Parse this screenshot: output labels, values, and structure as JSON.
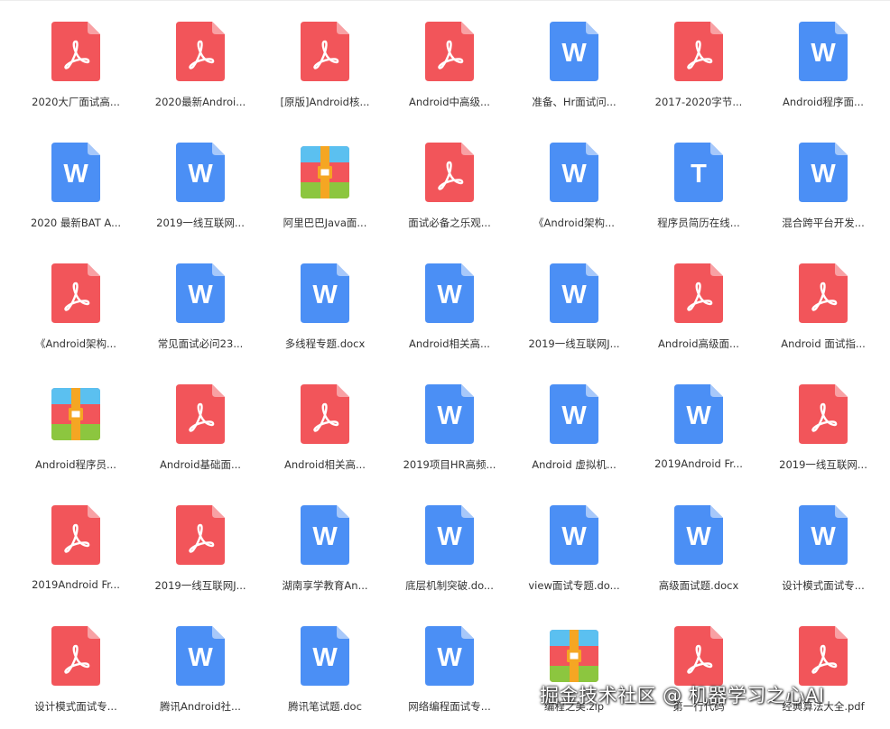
{
  "colors": {
    "pdf": "#f2555a",
    "pdf_fold": "#f8a1a4",
    "word": "#4b8ff5",
    "word_fold": "#a7c8fa",
    "text": "#4b8ff5",
    "zip_top": "#5bc0f0",
    "zip_mid": "#f2555a",
    "zip_bottom": "#8cc63f",
    "zip_strap": "#f5a623"
  },
  "icons": {
    "pdf": "pdf-file-icon",
    "word": "word-file-icon",
    "text": "text-file-icon",
    "zip": "zip-archive-icon",
    "word_letter": "W",
    "text_letter": "T"
  },
  "files": [
    [
      {
        "type": "pdf",
        "name": "2020大厂面试高..."
      },
      {
        "type": "pdf",
        "name": "2020最新Androi..."
      },
      {
        "type": "pdf",
        "name": "[原版]Android核..."
      },
      {
        "type": "pdf",
        "name": "Android中高级..."
      },
      {
        "type": "word",
        "name": "准备、Hr面试问..."
      },
      {
        "type": "pdf",
        "name": "2017-2020字节..."
      },
      {
        "type": "word",
        "name": "Android程序面..."
      }
    ],
    [
      {
        "type": "word",
        "name": "2020 最新BAT A..."
      },
      {
        "type": "word",
        "name": "2019一线互联网..."
      },
      {
        "type": "zip",
        "name": "阿里巴巴Java面..."
      },
      {
        "type": "pdf",
        "name": "面试必备之乐观..."
      },
      {
        "type": "word",
        "name": "《Android架构..."
      },
      {
        "type": "text",
        "name": "程序员简历在线..."
      },
      {
        "type": "word",
        "name": "混合跨平台开发..."
      }
    ],
    [
      {
        "type": "pdf",
        "name": "《Android架构..."
      },
      {
        "type": "word",
        "name": "常见面试必问23..."
      },
      {
        "type": "word",
        "name": "多线程专题.docx"
      },
      {
        "type": "word",
        "name": "Android相关高..."
      },
      {
        "type": "word",
        "name": "2019一线互联网J..."
      },
      {
        "type": "pdf",
        "name": "Android高级面..."
      },
      {
        "type": "pdf",
        "name": "Android 面试指..."
      }
    ],
    [
      {
        "type": "zip",
        "name": "Android程序员..."
      },
      {
        "type": "pdf",
        "name": "Android基础面..."
      },
      {
        "type": "pdf",
        "name": "Android相关高..."
      },
      {
        "type": "word",
        "name": "2019项目HR高频..."
      },
      {
        "type": "word",
        "name": "Android 虚拟机..."
      },
      {
        "type": "word",
        "name": "2019Android Fr..."
      },
      {
        "type": "pdf",
        "name": "2019一线互联网..."
      }
    ],
    [
      {
        "type": "pdf",
        "name": "2019Android Fr..."
      },
      {
        "type": "pdf",
        "name": "2019一线互联网J..."
      },
      {
        "type": "word",
        "name": "湖南享学教育An..."
      },
      {
        "type": "word",
        "name": "底层机制突破.do..."
      },
      {
        "type": "word",
        "name": "view面试专题.do..."
      },
      {
        "type": "word",
        "name": "高级面试题.docx"
      },
      {
        "type": "word",
        "name": "设计模式面试专..."
      }
    ],
    [
      {
        "type": "pdf",
        "name": "设计模式面试专..."
      },
      {
        "type": "word",
        "name": "腾讯Android社..."
      },
      {
        "type": "word",
        "name": "腾讯笔试题.doc"
      },
      {
        "type": "word",
        "name": "网络编程面试专..."
      },
      {
        "type": "zip",
        "name": "编程之美.zip"
      },
      {
        "type": "pdf",
        "name": "第一行代码"
      },
      {
        "type": "pdf",
        "name": "经典算法大全.pdf"
      }
    ]
  ],
  "watermark": "掘金技术社区 @ 机器学习之心AI"
}
